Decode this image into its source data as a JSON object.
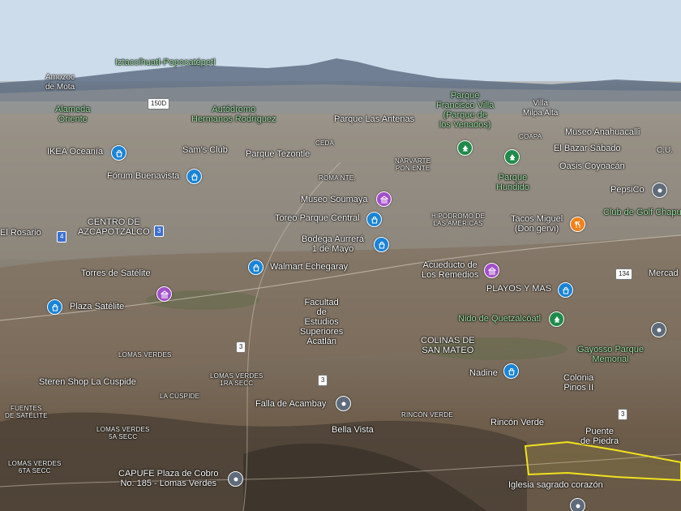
{
  "colors": {
    "shopping_pin": "#1a84d6",
    "museum_pin": "#a34fc9",
    "park_pin": "#1f8b4a",
    "food_pin": "#f0811a",
    "place_pin": "#5f6b7a",
    "highlight_outline": "#f2e21d"
  },
  "labels": {
    "iztaccihuatl": "Iztaccíhuatl-Popocatépetl",
    "amozoc": "Amozoc\nde Mota",
    "alameda": "Alameda\nOriente",
    "autodromo": "Autódromo\nHermanos Rodríguez",
    "parque_antenas": "Parque Las Antenas",
    "parque_fv": "Parque\nFrancisco Villa\n(Parque de\nlos Venados)",
    "villa_milpa": "Villa\nMilpa Alta",
    "museo_anahuacalli": "Museo Anahuacalli",
    "coapa": "COAPA",
    "ikea": "IKEA Oceanía",
    "sams": "Sam's Club",
    "parque_tezontle": "Parque Tezontle",
    "ceda": "CEDA",
    "narvarte": "NARVARTE\nPONIENTE",
    "bazar": "El Bazar Sábado",
    "cu": "C.U.",
    "oasis": "Oasis Coyoacán",
    "forum": "Fórum Buenavista",
    "roma": "ROMA NTE.",
    "parque_hundido": "Parque\nHundido",
    "pepsico": "PepsiCo",
    "museo_soumaya": "Museo Soumaya",
    "centro_azc": "CENTRO DE\nAZCAPOTZALCO",
    "el_rosario": "El Rosario",
    "toreo": "Toreo Parque Central",
    "hipodromo": "HIPÓDROMO DE\nLAS AMÉRICAS",
    "tacos_miguel": "Tacos Miguel\n(Don gervi)",
    "club_golf": "Club de Golf Chapul",
    "bodega": "Bodega Aurrerá\n1 de Mayo",
    "torres_satelite": "Torres de Satélite",
    "walmart": "Walmart Echegaray",
    "acueducto": "Acueducto de\nLos Remedios",
    "mercado": "Mercad",
    "playos": "PLAYOS Y MAS",
    "plaza_satelite": "Plaza Satélite",
    "facultad": "Facultad\nde\nEstudios\nSuperiores\nAcatlán",
    "nido": "Nido de Quetzalcóatl",
    "colinas": "COLINAS DE\nSAN MATEO",
    "lomas_verdes": "LOMAS VERDES",
    "gayosso": "Gayosso Parque\nMemorial",
    "steren": "Steren Shop La Cuspide",
    "lomas_1ra": "LOMAS VERDES\n1RA SECC",
    "nadine": "Nadine",
    "colonia_pinos": "Colonia\nPinos II",
    "la_cuspide": "LA CÚSPIDE",
    "fuentes_satelite": "FUENTES\nDE SATÉLITE",
    "falla": "Falla de Acambay",
    "rincon_verde_small": "RINCÓN VERDE",
    "lomas_5a": "LOMAS VERDES\n5A SECC",
    "bella_vista": "Bella Vista",
    "rincon_verde": "Rincón Verde",
    "puente_piedra": "Puente\nde Piedra",
    "lomas_6ta": "LOMAS VERDES\n6TA SECC",
    "capufe": "CAPUFE Plaza de Cobro\nNo. 185 - Lomas Verdes",
    "iglesia": "Iglesia sagrado corazón"
  },
  "shields": {
    "s150d": "150D",
    "s4": "4",
    "s3a": "3",
    "s134": "134",
    "s3b": "3",
    "s3c": "3",
    "s3d": "3"
  },
  "pins": [
    {
      "name": "ikea-pin",
      "kind": "shopping"
    },
    {
      "name": "forum-buenavista-pin",
      "kind": "shopping"
    },
    {
      "name": "museo-soumaya-pin",
      "kind": "museum"
    },
    {
      "name": "toreo-pin",
      "kind": "shopping"
    },
    {
      "name": "bodega-aurrera-pin",
      "kind": "shopping"
    },
    {
      "name": "walmart-pin",
      "kind": "shopping"
    },
    {
      "name": "plaza-satelite-pin",
      "kind": "shopping"
    },
    {
      "name": "torres-satelite-pin",
      "kind": "museum"
    },
    {
      "name": "acueducto-pin",
      "kind": "museum"
    },
    {
      "name": "playos-pin",
      "kind": "shopping"
    },
    {
      "name": "nido-pin",
      "kind": "park"
    },
    {
      "name": "parque-francisco-villa-pin",
      "kind": "park"
    },
    {
      "name": "parque-hundido-pin",
      "kind": "park"
    },
    {
      "name": "tacos-miguel-pin",
      "kind": "food"
    },
    {
      "name": "pepsico-pin",
      "kind": "place"
    },
    {
      "name": "nadine-pin",
      "kind": "shopping"
    },
    {
      "name": "falla-pin",
      "kind": "place"
    },
    {
      "name": "capufe-pin",
      "kind": "place"
    },
    {
      "name": "gayosso-pin",
      "kind": "place"
    },
    {
      "name": "iglesia-pin",
      "kind": "place"
    }
  ]
}
